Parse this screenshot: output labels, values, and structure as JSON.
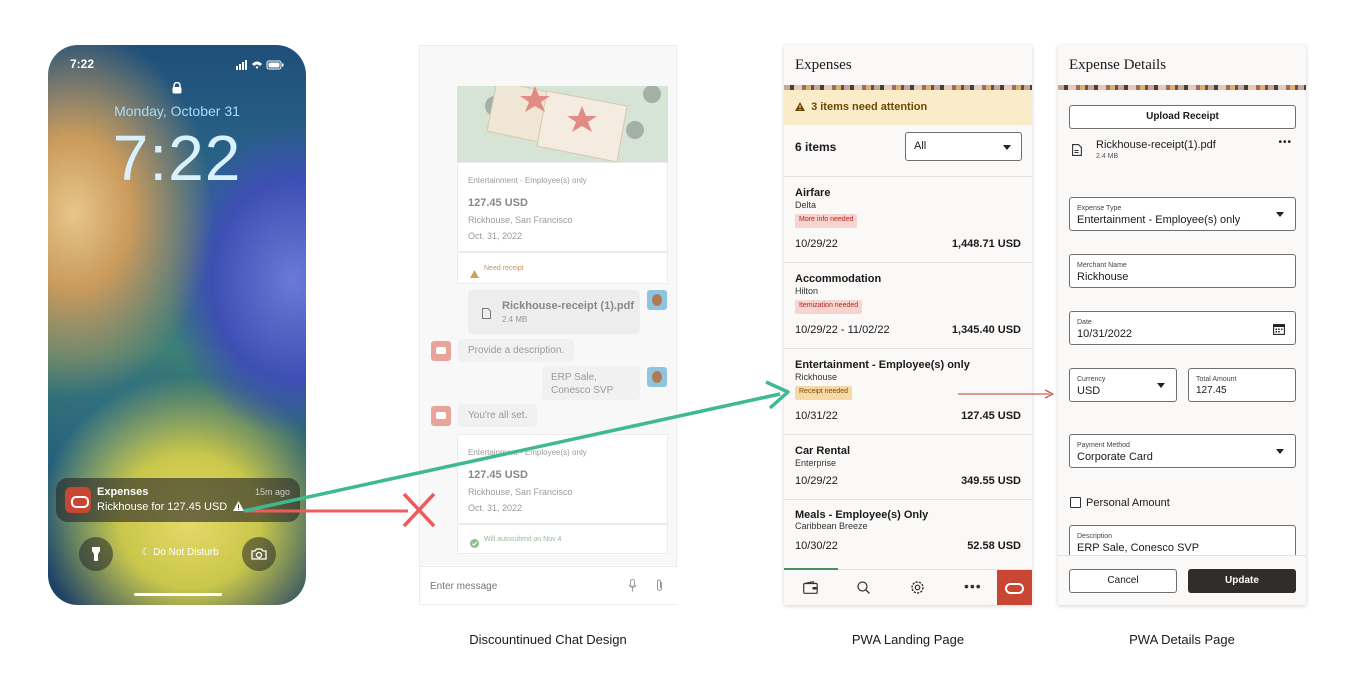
{
  "phone": {
    "status_time": "7:22",
    "date": "Monday, October 31",
    "clock": "7:22",
    "notification": {
      "app": "Expenses",
      "body": "Rickhouse for 127.45 USD",
      "time": "15m ago"
    },
    "do_not_disturb": "Do Not Disturb"
  },
  "chat": {
    "card1": {
      "type": "Entertainment - Employee(s) only",
      "amount": "127.45 USD",
      "merchant": "Rickhouse, San Francisco",
      "date": "Oct. 31, 2022",
      "warning": "Need receipt"
    },
    "attachment": {
      "name": "Rickhouse-receipt (1).pdf",
      "size": "2.4 MB"
    },
    "bot_msg1": "Provide a description.",
    "user_msg": "ERP Sale,\nConesco SVP",
    "bot_msg2": "You're all set.",
    "card2": {
      "type": "Entertainment - Employee(s) only",
      "amount": "127.45 USD",
      "merchant": "Rickhouse, San Francisco",
      "date": "Oct. 31, 2022",
      "status": "Will autosubmit on Nov 4"
    },
    "composer_placeholder": "Enter message"
  },
  "landing": {
    "title": "Expenses",
    "banner": "3 items need attention",
    "count": "6 items",
    "filter_value": "All",
    "items": [
      {
        "name": "Airfare",
        "merchant": "Delta",
        "badge": "More info needed",
        "date": "10/29/22",
        "amount": "1,448.71 USD"
      },
      {
        "name": "Accommodation",
        "merchant": "Hilton",
        "badge": "Itemization needed",
        "date": "10/29/22 - 11/02/22",
        "amount": "1,345.40 USD"
      },
      {
        "name": "Entertainment - Employee(s) only",
        "merchant": "Rickhouse",
        "badge": "Receipt needed",
        "date": "10/31/22",
        "amount": "127.45 USD"
      },
      {
        "name": "Car Rental",
        "merchant": "Enterprise",
        "badge": "",
        "date": "10/29/22",
        "amount": "349.55 USD"
      },
      {
        "name": "Meals - Employee(s) Only",
        "merchant": "Caribbean Breeze",
        "badge": "",
        "date": "10/30/22",
        "amount": "52.58 USD"
      }
    ],
    "colors": {
      "badge_red": "#f8d4d0",
      "badge_red_text": "#b3261e",
      "badge_amber": "#f6d9a6",
      "badge_amber_text": "#7a4b00",
      "accent": "#c74634"
    }
  },
  "details": {
    "title": "Expense Details",
    "upload_label": "Upload Receipt",
    "file_name": "Rickhouse-receipt(1).pdf",
    "file_size": "2.4 MB",
    "expense_type_label": "Expense Type",
    "expense_type_value": "Entertainment - Employee(s) only",
    "merchant_label": "Merchant Name",
    "merchant_value": "Rickhouse",
    "date_label": "Date",
    "date_value": "10/31/2022",
    "currency_label": "Currency",
    "currency_value": "USD",
    "total_label": "Total Amount",
    "total_value": "127.45",
    "payment_label": "Payment Method",
    "payment_value": "Corporate Card",
    "personal_label": "Personal Amount",
    "description_label": "Description",
    "description_value": "ERP Sale, Conesco SVP",
    "cancel_label": "Cancel",
    "update_label": "Update"
  },
  "captions": {
    "chat": "Discountinued Chat Design",
    "landing": "PWA Landing Page",
    "details": "PWA Details Page"
  }
}
